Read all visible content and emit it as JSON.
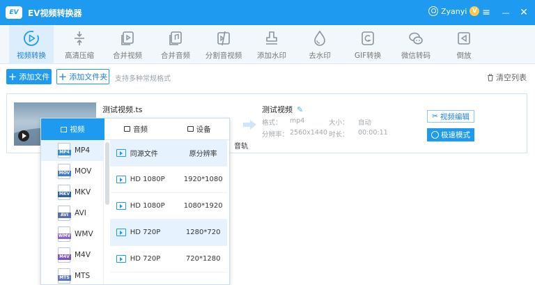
{
  "app": {
    "logo_text": "EV",
    "title": "EV视频转换器"
  },
  "user": {
    "name": "Zyanyi",
    "badge": "V",
    "badge_color": "#ffc94a"
  },
  "window_controls": {
    "menu": "≡",
    "minimize": "—",
    "close": "✕"
  },
  "colors": {
    "accent": "#1e9bf0",
    "active_tool_bg": "#dceefc"
  },
  "toolbar": {
    "items": [
      {
        "label": "视频转换",
        "icon": "video-convert-icon",
        "active": true
      },
      {
        "label": "高清压缩",
        "icon": "compress-icon"
      },
      {
        "label": "合并视频",
        "icon": "merge-video-icon"
      },
      {
        "label": "合并音频",
        "icon": "merge-audio-icon"
      },
      {
        "label": "分割音视频",
        "icon": "split-icon"
      },
      {
        "label": "添加水印",
        "icon": "stamp-icon"
      },
      {
        "label": "去水印",
        "icon": "drop-icon"
      },
      {
        "label": "GIF转换",
        "icon": "gif-icon"
      },
      {
        "label": "微信转码",
        "icon": "wechat-icon"
      },
      {
        "label": "倒放",
        "icon": "reverse-icon"
      }
    ]
  },
  "actions": {
    "add_file": "添加文件",
    "add_folder": "添加文件夹",
    "hint": "支持多种常规格式",
    "clear_list": "清空列表"
  },
  "file": {
    "name": "测试视频.ts",
    "audio_track_suffix": "音轨",
    "output_name": "测试视频",
    "format_label": "格式：",
    "format": "mp4",
    "size_label": "大小：",
    "size": "自动",
    "resolution_label": "分辨率：",
    "resolution": "2560x1440",
    "duration_label": "时长：",
    "duration": "00:00:11",
    "edit_button": "视频编辑",
    "speed_button": "极速模式"
  },
  "format_popup": {
    "tabs": [
      {
        "label": "视频",
        "active": true
      },
      {
        "label": "音频"
      },
      {
        "label": "设备"
      }
    ],
    "formats": [
      {
        "label": "MP4",
        "badge_color": "#2d8ce6",
        "active": true
      },
      {
        "label": "MOV",
        "badge_color": "#3a7bd5"
      },
      {
        "label": "MKV",
        "badge_color": "#2b5fa8"
      },
      {
        "label": "AVI",
        "badge_color": "#5b6fb0"
      },
      {
        "label": "WMV",
        "badge_color": "#8a63c7"
      },
      {
        "label": "M4V",
        "badge_color": "#7a55c2"
      },
      {
        "label": "MTS",
        "badge_color": "#5f74c9"
      }
    ],
    "presets": [
      {
        "name": "同源文件",
        "resolution": "原分辨率",
        "active": true
      },
      {
        "name": "HD 1080P",
        "resolution": "1920*1080"
      },
      {
        "name": "HD 1080P",
        "resolution": "1080*1920"
      },
      {
        "name": "HD 720P",
        "resolution": "1280*720",
        "active": true
      },
      {
        "name": "HD 720P",
        "resolution": "720*1280"
      }
    ]
  }
}
